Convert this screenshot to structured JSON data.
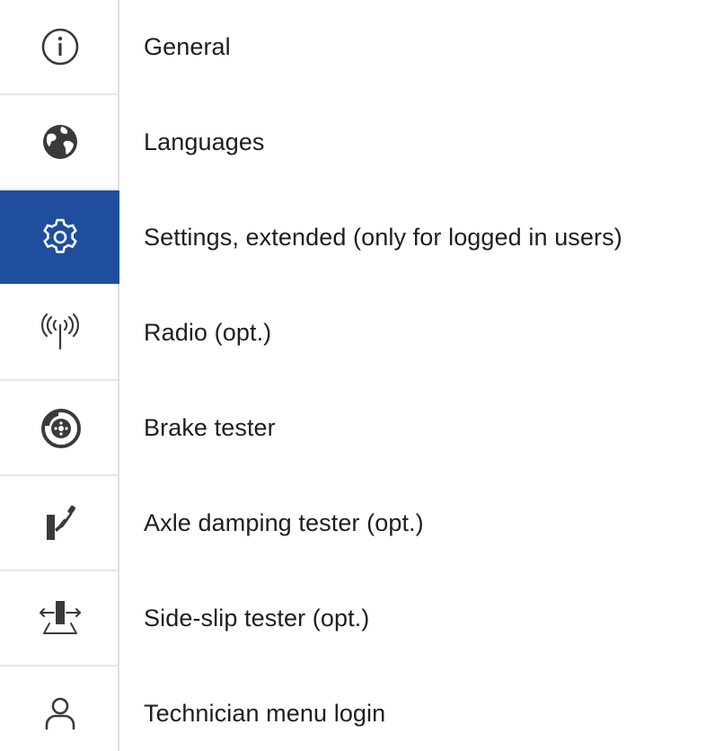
{
  "menu": {
    "items": [
      {
        "label": "General",
        "icon": "info-icon",
        "active": false
      },
      {
        "label": "Languages",
        "icon": "globe-icon",
        "active": false
      },
      {
        "label": "Settings, extended (only for logged in users)",
        "icon": "gear-icon",
        "active": true
      },
      {
        "label": "Radio (opt.)",
        "icon": "radio-antenna-icon",
        "active": false
      },
      {
        "label": "Brake tester",
        "icon": "brake-disc-icon",
        "active": false
      },
      {
        "label": "Axle damping tester (opt.)",
        "icon": "shock-absorber-icon",
        "active": false
      },
      {
        "label": "Side-slip tester (opt.)",
        "icon": "side-slip-icon",
        "active": false
      },
      {
        "label": "Technician menu login",
        "icon": "user-icon",
        "active": false
      }
    ]
  },
  "colors": {
    "active_background": "#1f4e9e",
    "icon": "#3a3a3a",
    "text": "#1e1e1e",
    "divider": "#e6e6e6"
  }
}
